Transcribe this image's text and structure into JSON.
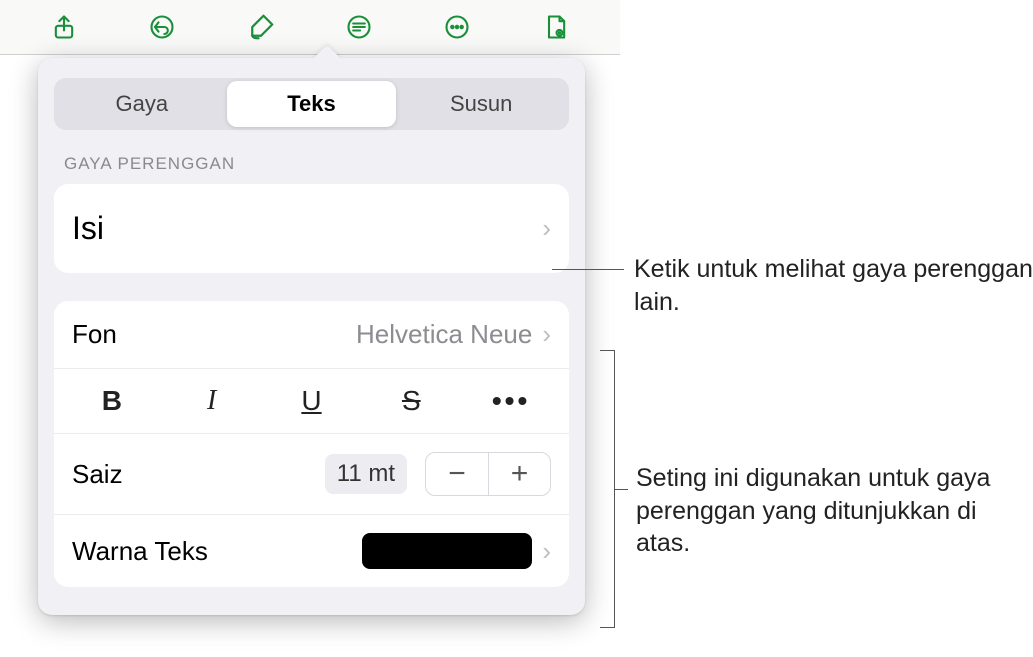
{
  "toolbar": {
    "icons": [
      "share-icon",
      "undo-icon",
      "format-brush-icon",
      "insert-icon",
      "more-icon",
      "read-mode-icon"
    ]
  },
  "tabs": {
    "items": [
      "Gaya",
      "Teks",
      "Susun"
    ],
    "active_index": 1
  },
  "section_label": "GAYA PERENGGAN",
  "paragraph_style": {
    "value": "Isi"
  },
  "font": {
    "label": "Fon",
    "value": "Helvetica Neue"
  },
  "styles": {
    "bold": "B",
    "italic": "I",
    "underline": "U",
    "strike": "S",
    "more": "•••"
  },
  "size": {
    "label": "Saiz",
    "value": "11 mt",
    "minus": "−",
    "plus": "+"
  },
  "text_color": {
    "label": "Warna Teks",
    "swatch": "#000000"
  },
  "callouts": {
    "c1": "Ketik untuk melihat gaya perenggan lain.",
    "c2": "Seting ini digunakan untuk gaya perenggan yang ditunjukkan di atas."
  }
}
